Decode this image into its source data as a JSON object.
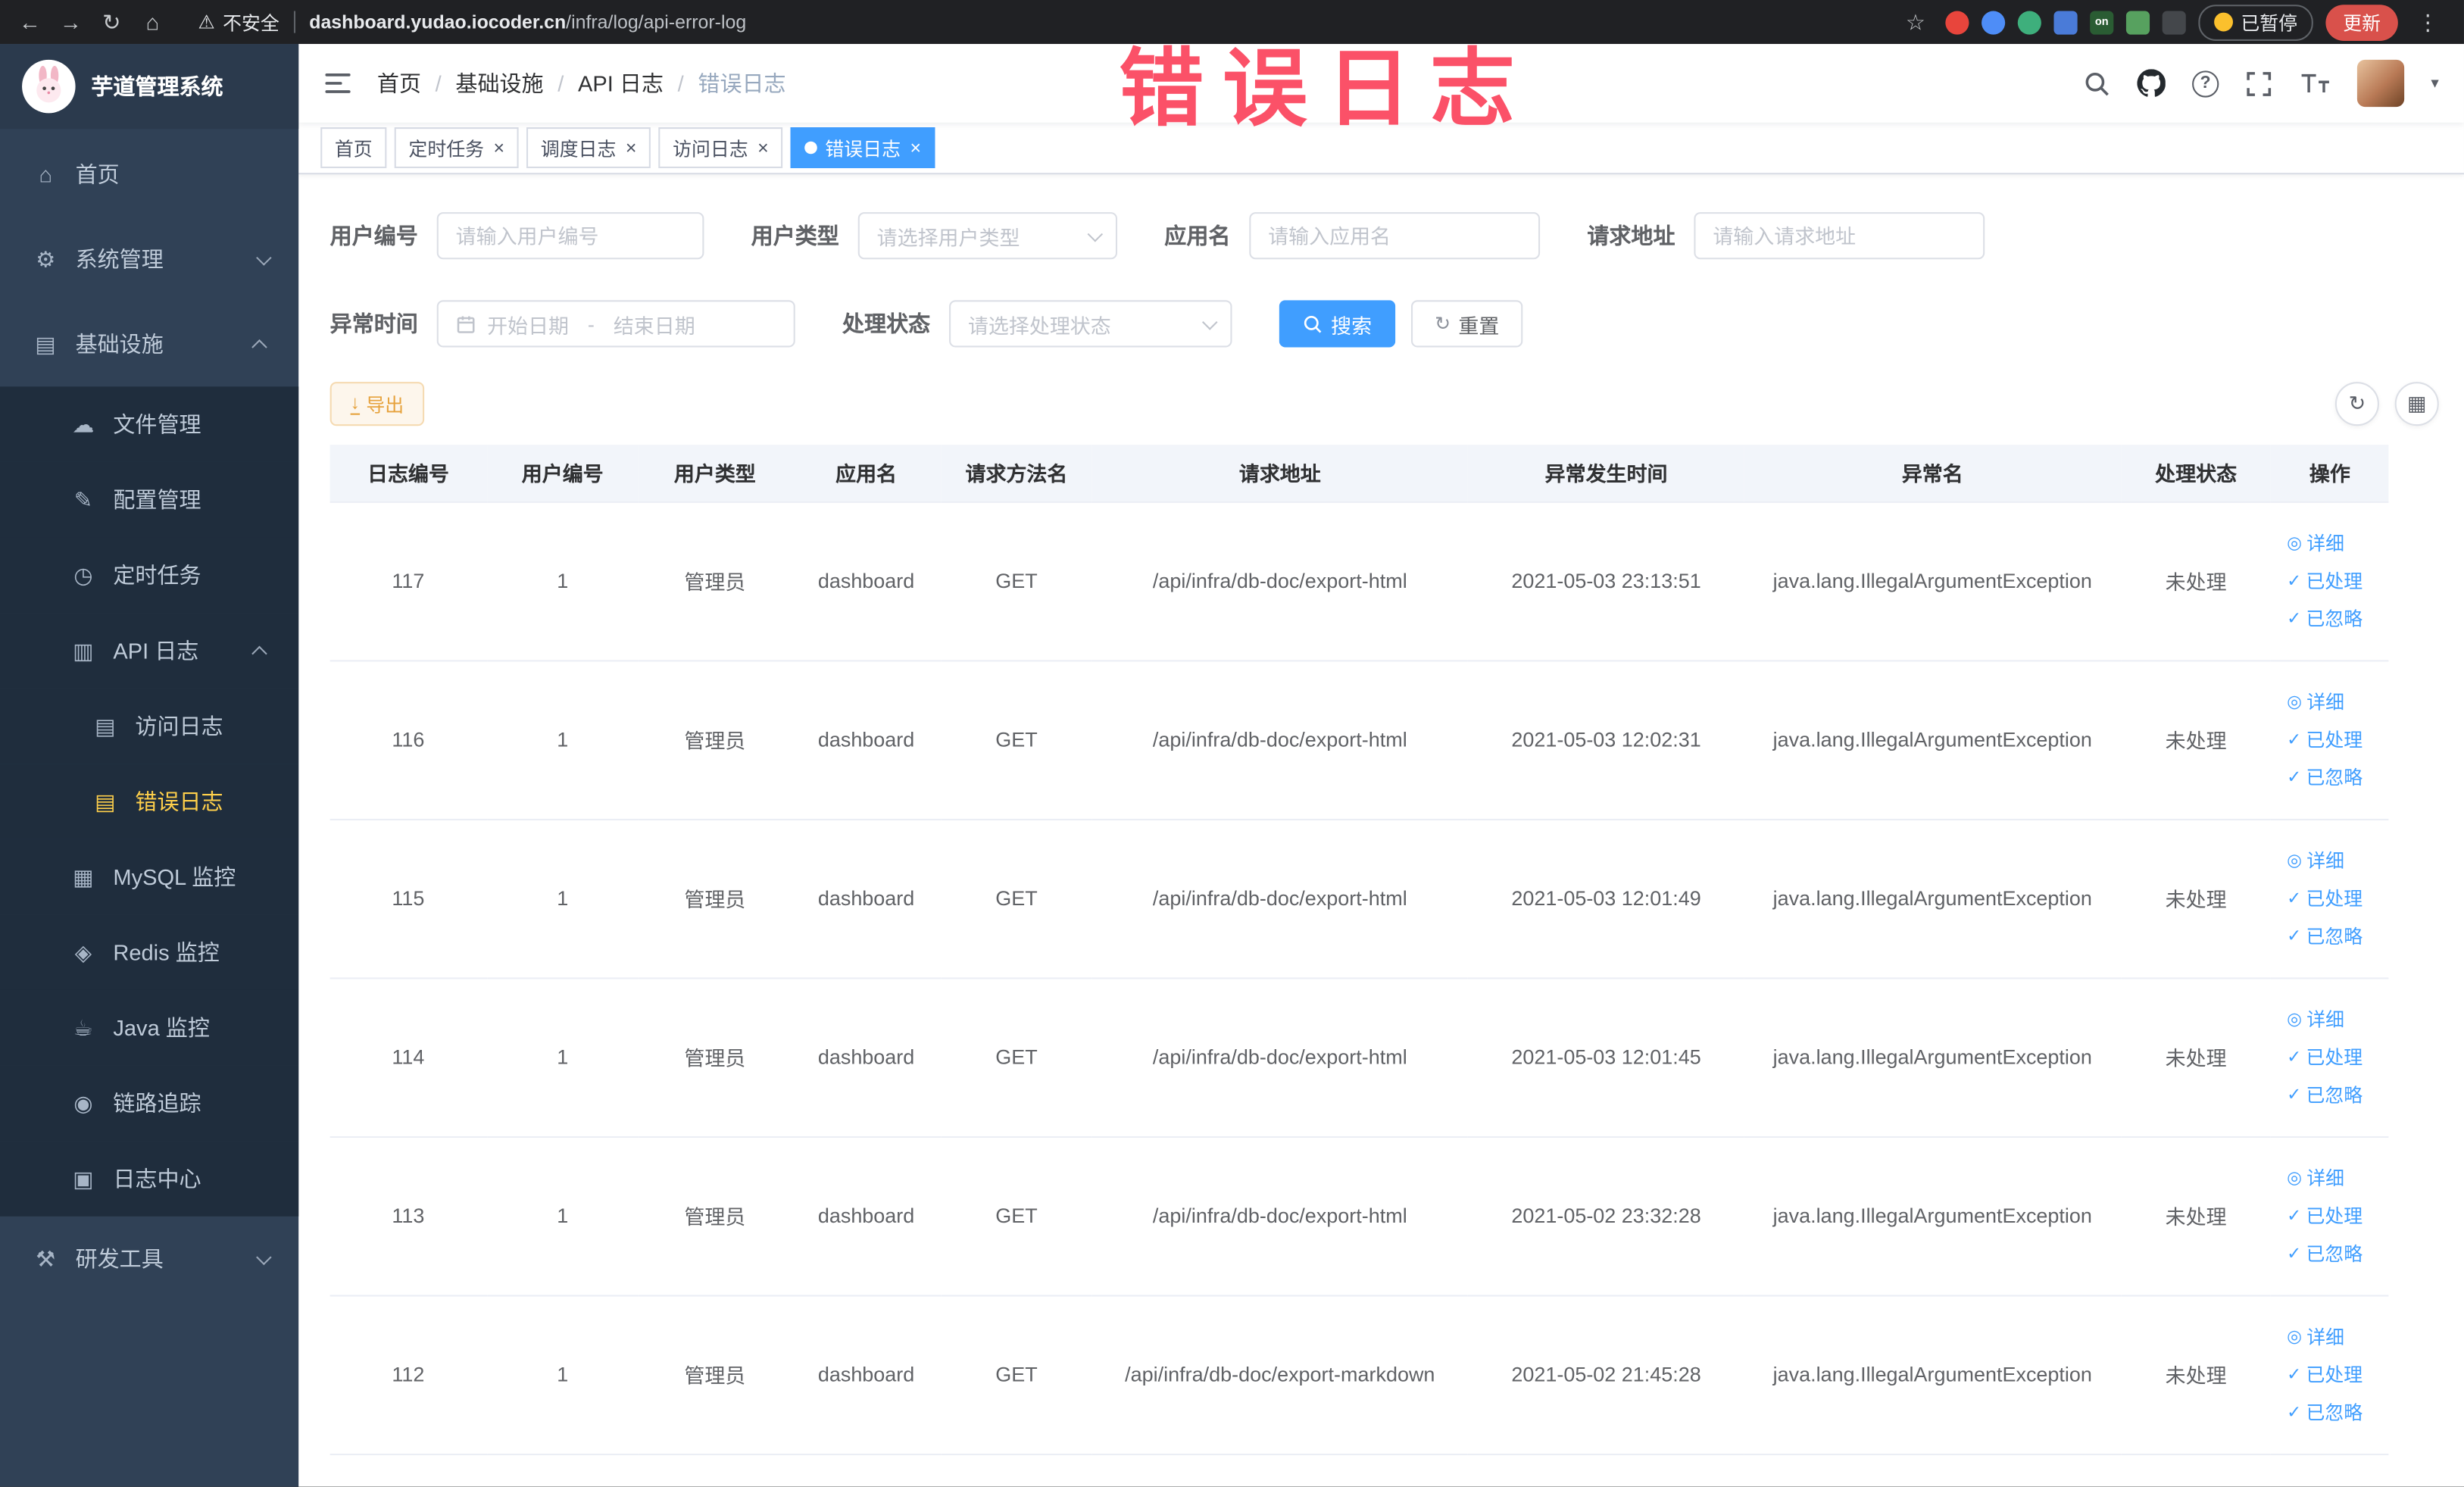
{
  "browser": {
    "security_label": "不安全",
    "url_domain": "dashboard.yudao.iocoder.cn",
    "url_path": "/infra/log/api-error-log",
    "extension_on_label": "on",
    "paused_label": "已暂停",
    "update_label": "更新"
  },
  "icons": {
    "back": "←",
    "forward": "→",
    "reload": "↻",
    "home": "⌂",
    "warning": "⚠",
    "star": "☆",
    "kebab": "⋮",
    "caret": "▾",
    "question": "?",
    "close": "×",
    "download": "↓",
    "grid": "▦"
  },
  "sidebar": {
    "logo_title": "芋道管理系统",
    "items": [
      {
        "key": "home",
        "label": "首页",
        "glyph": "⌂",
        "icon": "home-icon",
        "level": 1,
        "type": "item"
      },
      {
        "key": "system-manage",
        "label": "系统管理",
        "glyph": "⚙",
        "icon": "gear-icon",
        "level": 1,
        "type": "submenu",
        "expanded": false
      },
      {
        "key": "infrastructure",
        "label": "基础设施",
        "glyph": "▤",
        "icon": "infrastructure-icon",
        "level": 1,
        "type": "submenu",
        "expanded": true
      },
      {
        "key": "file-manage",
        "label": "文件管理",
        "glyph": "☁",
        "icon": "file-icon",
        "level": 2,
        "type": "item"
      },
      {
        "key": "config-manage",
        "label": "配置管理",
        "glyph": "✎",
        "icon": "edit-icon",
        "level": 2,
        "type": "item"
      },
      {
        "key": "scheduled-job",
        "label": "定时任务",
        "glyph": "◷",
        "icon": "clock-icon",
        "level": 2,
        "type": "item"
      },
      {
        "key": "api-log",
        "label": "API 日志",
        "glyph": "▥",
        "icon": "document-icon",
        "level": 2,
        "type": "submenu",
        "expanded": true
      },
      {
        "key": "access-log",
        "label": "访问日志",
        "glyph": "▤",
        "icon": "document-icon",
        "level": 3,
        "type": "item"
      },
      {
        "key": "error-log",
        "label": "错误日志",
        "glyph": "▤",
        "icon": "document-icon",
        "level": 3,
        "type": "item",
        "active": true
      },
      {
        "key": "mysql-monitor",
        "label": "MySQL 监控",
        "glyph": "▦",
        "icon": "database-icon",
        "level": 2,
        "type": "item"
      },
      {
        "key": "redis-monitor",
        "label": "Redis 监控",
        "glyph": "◈",
        "icon": "redis-icon",
        "level": 2,
        "type": "item"
      },
      {
        "key": "java-monitor",
        "label": "Java 监控",
        "glyph": "☕",
        "icon": "java-icon",
        "level": 2,
        "type": "item"
      },
      {
        "key": "trace",
        "label": "链路追踪",
        "glyph": "◉",
        "icon": "eye-icon",
        "level": 2,
        "type": "item"
      },
      {
        "key": "log-center",
        "label": "日志中心",
        "glyph": "▣",
        "icon": "log-center-icon",
        "level": 2,
        "type": "item"
      },
      {
        "key": "dev-tools",
        "label": "研发工具",
        "glyph": "⚒",
        "icon": "tools-icon",
        "level": 1,
        "type": "submenu",
        "expanded": false
      }
    ]
  },
  "header": {
    "breadcrumb": [
      "首页",
      "基础设施",
      "API 日志",
      "错误日志"
    ]
  },
  "overlay": {
    "watermark": "错误日志"
  },
  "tabs": [
    {
      "key": "home",
      "label": "首页",
      "closable": false,
      "active": false
    },
    {
      "key": "scheduled-job",
      "label": "定时任务",
      "closable": true,
      "active": false
    },
    {
      "key": "job-log",
      "label": "调度日志",
      "closable": true,
      "active": false
    },
    {
      "key": "access-log",
      "label": "访问日志",
      "closable": true,
      "active": false
    },
    {
      "key": "error-log",
      "label": "错误日志",
      "closable": true,
      "active": true
    }
  ],
  "filters": {
    "user_id": {
      "label": "用户编号",
      "placeholder": "请输入用户编号"
    },
    "user_type": {
      "label": "用户类型",
      "placeholder": "请选择用户类型"
    },
    "app_name": {
      "label": "应用名",
      "placeholder": "请输入应用名"
    },
    "request_url": {
      "label": "请求地址",
      "placeholder": "请输入请求地址"
    },
    "exception_time": {
      "label": "异常时间",
      "start_placeholder": "开始日期",
      "separator": "-",
      "end_placeholder": "结束日期"
    },
    "process_status": {
      "label": "处理状态",
      "placeholder": "请选择处理状态"
    },
    "search_label": "搜索",
    "reset_label": "重置"
  },
  "toolbar": {
    "export_label": "导出"
  },
  "table": {
    "columns": [
      "日志编号",
      "用户编号",
      "用户类型",
      "应用名",
      "请求方法名",
      "请求地址",
      "异常发生时间",
      "异常名",
      "处理状态",
      "操作"
    ],
    "row_actions": [
      {
        "key": "detail",
        "label": "详细",
        "glyph": "◎"
      },
      {
        "key": "processed",
        "label": "已处理",
        "glyph": "✓"
      },
      {
        "key": "ignored",
        "label": "已忽略",
        "glyph": "✓"
      }
    ],
    "rows": [
      {
        "cells": [
          "117",
          "1",
          "管理员",
          "dashboard",
          "GET",
          "/api/infra/db-doc/export-html",
          "2021-05-03 23:13:51",
          "java.lang.IllegalArgumentException",
          "未处理"
        ]
      },
      {
        "cells": [
          "116",
          "1",
          "管理员",
          "dashboard",
          "GET",
          "/api/infra/db-doc/export-html",
          "2021-05-03 12:02:31",
          "java.lang.IllegalArgumentException",
          "未处理"
        ]
      },
      {
        "cells": [
          "115",
          "1",
          "管理员",
          "dashboard",
          "GET",
          "/api/infra/db-doc/export-html",
          "2021-05-03 12:01:49",
          "java.lang.IllegalArgumentException",
          "未处理"
        ]
      },
      {
        "cells": [
          "114",
          "1",
          "管理员",
          "dashboard",
          "GET",
          "/api/infra/db-doc/export-html",
          "2021-05-03 12:01:45",
          "java.lang.IllegalArgumentException",
          "未处理"
        ]
      },
      {
        "cells": [
          "113",
          "1",
          "管理员",
          "dashboard",
          "GET",
          "/api/infra/db-doc/export-html",
          "2021-05-02 23:32:28",
          "java.lang.IllegalArgumentException",
          "未处理"
        ]
      },
      {
        "cells": [
          "112",
          "1",
          "管理员",
          "dashboard",
          "GET",
          "/api/infra/db-doc/export-markdown",
          "2021-05-02 21:45:28",
          "java.lang.IllegalArgumentException",
          "未处理"
        ]
      }
    ]
  },
  "colors": {
    "accent_blue": "#409eff",
    "sidebar_bg": "#304156",
    "sidebar_submenu_bg": "#1f2d3d",
    "active_menu_text": "#ffd04b",
    "watermark_red": "#fb4860",
    "export_warning": "#e6a23c",
    "active_tab_bg": "#409eff"
  }
}
